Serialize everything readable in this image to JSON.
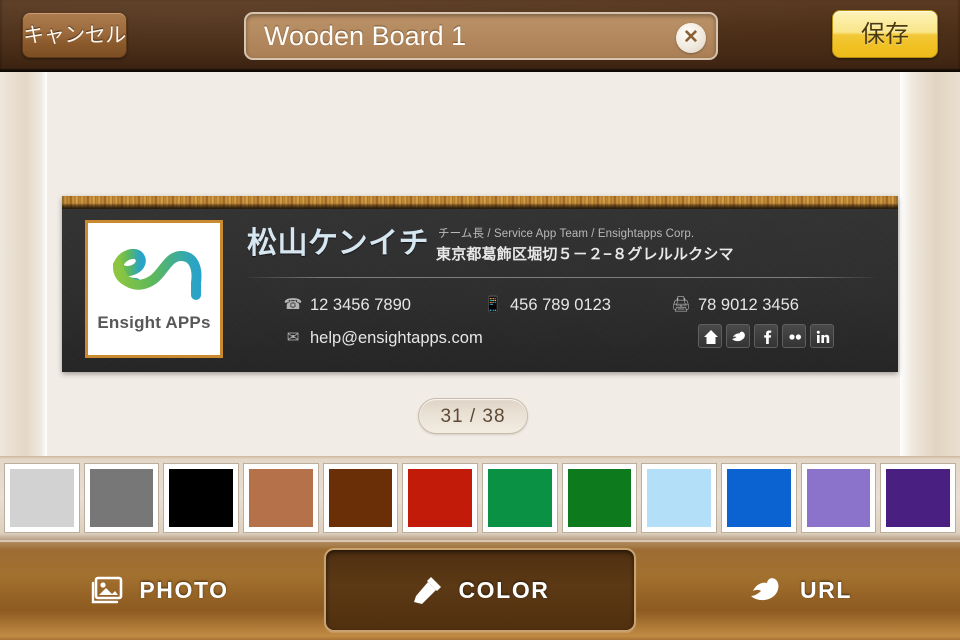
{
  "topbar": {
    "cancel_label": "キャンセル",
    "title_value": "Wooden Board 1",
    "title_placeholder": "Wooden Board 1",
    "clear_icon": "close-x-icon",
    "save_label": "保存"
  },
  "card": {
    "logo_alt": "en-logo-icon",
    "logo_text": "Ensight APPs",
    "name": "松山ケンイチ",
    "role": "チーム長 / Service App Team / Ensightapps Corp.",
    "address": "東京都葛飾区堀切５－２−８グレルルクシマ",
    "tel_icon": "phone-icon",
    "tel": "12 3456 7890",
    "mobile_icon": "mobile-phone-icon",
    "mobile": "456 789 0123",
    "fax_icon": "fax-icon",
    "fax": "78 9012 3456",
    "email_icon": "envelope-icon",
    "email": "help@ensightapps.com",
    "social": [
      {
        "name": "home-icon",
        "label": "Home"
      },
      {
        "name": "twitter-icon",
        "label": "Twitter"
      },
      {
        "name": "facebook-icon",
        "label": "Facebook"
      },
      {
        "name": "flickr-icon",
        "label": "Flickr"
      },
      {
        "name": "linkedin-icon",
        "label": "LinkedIn"
      }
    ]
  },
  "counter": {
    "text": "31 / 38",
    "current": 31,
    "total": 38
  },
  "palette": {
    "swatches": [
      {
        "name": "swatch-light-gray",
        "color": "#d2d2d2"
      },
      {
        "name": "swatch-gray",
        "color": "#777777"
      },
      {
        "name": "swatch-black",
        "color": "#000000"
      },
      {
        "name": "swatch-tan",
        "color": "#b5714a"
      },
      {
        "name": "swatch-brown",
        "color": "#6b2f08"
      },
      {
        "name": "swatch-red",
        "color": "#c21b09"
      },
      {
        "name": "swatch-green",
        "color": "#0a9144"
      },
      {
        "name": "swatch-dark-green",
        "color": "#0c7a1d"
      },
      {
        "name": "swatch-light-blue",
        "color": "#b3e0f8"
      },
      {
        "name": "swatch-blue",
        "color": "#0a63d0"
      },
      {
        "name": "swatch-purple",
        "color": "#8b72cb"
      },
      {
        "name": "swatch-dark-purple",
        "color": "#4a1f82"
      }
    ]
  },
  "tabbar": {
    "tabs": [
      {
        "name": "tab-photo",
        "label": "PHOTO",
        "icon": "photo-icon",
        "selected": false
      },
      {
        "name": "tab-color",
        "label": "COLOR",
        "icon": "eyedropper-icon",
        "selected": true
      },
      {
        "name": "tab-url",
        "label": "URL",
        "icon": "twitter-bird-icon",
        "selected": false
      }
    ]
  }
}
